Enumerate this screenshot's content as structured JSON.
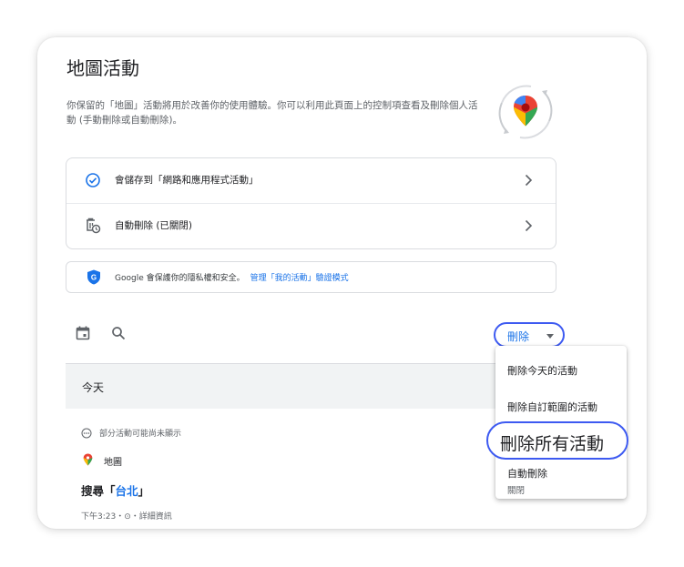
{
  "page": {
    "title": "地圖活動",
    "description": "你保留的「地圖」活動將用於改善你的使用體驗。你可以利用此頁面上的控制項查看及刪除個人活動 (手動刪除或自動刪除)。"
  },
  "settings": [
    {
      "label": "會儲存到「網路和應用程式活動」",
      "icon": "check-circle-icon"
    },
    {
      "label": "自動刪除 (已關閉)",
      "icon": "auto-delete-icon"
    }
  ],
  "privacy": {
    "text": "Google 會保護你的隱私權和安全。",
    "link": "管理「我的活動」驗證模式",
    "icon": "google-shield-icon"
  },
  "toolbar": {
    "delete_label": "刪除",
    "calendar_icon": "calendar-icon",
    "search_icon": "search-icon"
  },
  "section": {
    "label": "今天"
  },
  "activity": {
    "notice": "部分活動可能尚未顯示",
    "app": "地圖",
    "query_prefix": "搜尋「",
    "query_term": "台北",
    "query_suffix": "」",
    "meta": "下午3:23・⊙・詳細資訊"
  },
  "menu": {
    "items": [
      {
        "label": "刪除今天的活動"
      },
      {
        "label": "刪除自訂範圍的活動"
      },
      {
        "label": "刪除所有活動"
      },
      {
        "label": "自動刪除",
        "sub": "關閉"
      }
    ]
  },
  "colors": {
    "accent": "#1a73e8",
    "highlight": "#3d5af1"
  }
}
